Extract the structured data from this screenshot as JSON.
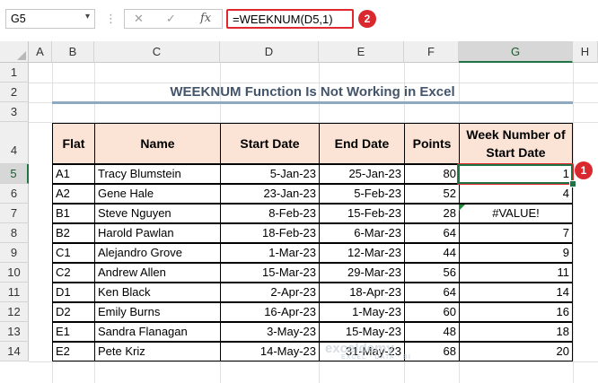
{
  "formula_bar": {
    "name_box": "G5",
    "dots": "⋮",
    "cancel_icon": "✕",
    "enter_icon": "✓",
    "fx_label": "fx",
    "formula": "=WEEKNUM(D5,1)"
  },
  "badges": {
    "formula": "2",
    "cell": "1"
  },
  "columns": [
    "A",
    "B",
    "C",
    "D",
    "E",
    "F",
    "G",
    "H"
  ],
  "rows": [
    "1",
    "2",
    "3",
    "4",
    "5",
    "6",
    "7",
    "8",
    "9",
    "10",
    "11",
    "12",
    "13",
    "14"
  ],
  "title": "WEEKNUM Function Is Not Working in Excel",
  "table": {
    "headers": [
      "Flat",
      "Name",
      "Start Date",
      "End Date",
      "Points",
      "Week Number of Start Date"
    ],
    "rows": [
      [
        "A1",
        "Tracy Blumstein",
        "5-Jan-23",
        "25-Jan-23",
        "80",
        "1"
      ],
      [
        "A2",
        "Gene Hale",
        "23-Jan-23",
        "5-Feb-23",
        "52",
        "4"
      ],
      [
        "B1",
        "Steve Nguyen",
        "8-Feb-23",
        "15-Feb-23",
        "28",
        "#VALUE!"
      ],
      [
        "B2",
        "Harold Pawlan",
        "18-Feb-23",
        "6-Mar-23",
        "64",
        "7"
      ],
      [
        "C1",
        "Alejandro Grove",
        "1-Mar-23",
        "12-Mar-23",
        "44",
        "9"
      ],
      [
        "C2",
        "Andrew Allen",
        "15-Mar-23",
        "29-Mar-23",
        "56",
        "11"
      ],
      [
        "D1",
        "Ken Black",
        "2-Apr-23",
        "18-Apr-23",
        "64",
        "14"
      ],
      [
        "D2",
        "Emily Burns",
        "16-Apr-23",
        "1-May-23",
        "60",
        "16"
      ],
      [
        "E1",
        "Sandra Flanagan",
        "3-May-23",
        "15-May-23",
        "48",
        "18"
      ],
      [
        "E2",
        "Pete Kriz",
        "14-May-23",
        "31-May-23",
        "68",
        "20"
      ]
    ]
  },
  "watermark": {
    "brand": "exceldemy",
    "tagline": "EXCEL · DATA · BI"
  },
  "colors": {
    "header_fill": "#fbe3d6",
    "title_color": "#44546a",
    "accent_red": "#e0292f",
    "excel_green": "#217346"
  }
}
